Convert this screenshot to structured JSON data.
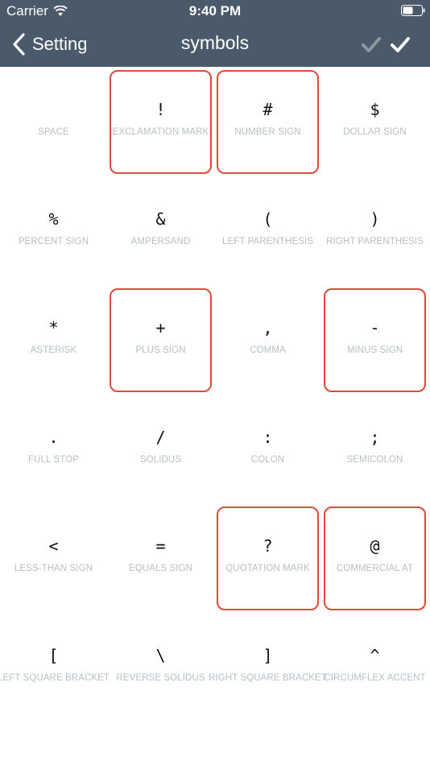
{
  "status": {
    "carrier": "Carrier",
    "time": "9:40 PM"
  },
  "nav": {
    "back_label": "Setting",
    "title": "symbols",
    "check_left_icon": "checkmark-icon",
    "check_right_icon": "checkmark-icon"
  },
  "colors": {
    "nav_bg": "#4b5a6a",
    "selection_border": "#e04a3a",
    "label_gray": "#b7bfc4"
  },
  "symbols": [
    {
      "symbol": " ",
      "name": "SPACE",
      "selected": false
    },
    {
      "symbol": "!",
      "name": "EXCLAMATION MARK",
      "selected": true
    },
    {
      "symbol": "#",
      "name": "NUMBER SIGN",
      "selected": true
    },
    {
      "symbol": "$",
      "name": "DOLLAR SIGN",
      "selected": false
    },
    {
      "symbol": "%",
      "name": "PERCENT SIGN",
      "selected": false
    },
    {
      "symbol": "&",
      "name": "AMPERSAND",
      "selected": false
    },
    {
      "symbol": "(",
      "name": "LEFT PARENTHESIS",
      "selected": false
    },
    {
      "symbol": ")",
      "name": "RIGHT PARENTHESIS",
      "selected": false
    },
    {
      "symbol": "*",
      "name": "ASTERISK",
      "selected": false
    },
    {
      "symbol": "+",
      "name": "PLUS SIGN",
      "selected": true
    },
    {
      "symbol": ",",
      "name": "COMMA",
      "selected": false
    },
    {
      "symbol": "-",
      "name": "MINUS SIGN",
      "selected": true
    },
    {
      "symbol": ".",
      "name": "FULL STOP",
      "selected": false
    },
    {
      "symbol": "/",
      "name": "SOLIDUS",
      "selected": false
    },
    {
      "symbol": ":",
      "name": "COLON",
      "selected": false
    },
    {
      "symbol": ";",
      "name": "SEMICOLON",
      "selected": false
    },
    {
      "symbol": "<",
      "name": "LESS-THAN SIGN",
      "selected": false
    },
    {
      "symbol": "=",
      "name": "EQUALS SIGN",
      "selected": false
    },
    {
      "symbol": "?",
      "name": "QUOTATION MARK",
      "selected": true
    },
    {
      "symbol": "@",
      "name": "COMMERCIAL AT",
      "selected": true
    },
    {
      "symbol": "[",
      "name": "LEFT SQUARE BRACKET",
      "selected": false
    },
    {
      "symbol": "\\",
      "name": "REVERSE SOLIDUS",
      "selected": false
    },
    {
      "symbol": "]",
      "name": "RIGHT SQUARE BRACKET",
      "selected": false
    },
    {
      "symbol": "^",
      "name": "CIRCUMFLEX ACCENT",
      "selected": false
    }
  ]
}
